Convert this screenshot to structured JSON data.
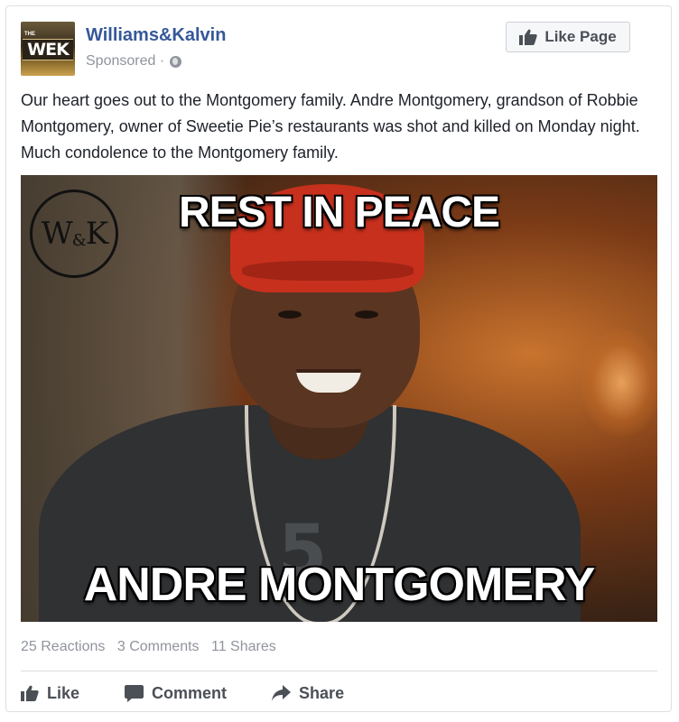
{
  "post": {
    "page_name": "Williams&Kalvin",
    "sponsored": "Sponsored ·",
    "privacy_icon": "globe-icon",
    "like_page_label": "Like Page",
    "avatar_text_small": "THE",
    "avatar_text": "WEK",
    "text": "Our heart goes out to the Montgomery family. Andre Montgomery, grandson of Robbie Montgomery, owner of Sweetie Pie’s restaurants was shot and killed on Monday night. Much condolence to the Montgomery family."
  },
  "image": {
    "top_caption": "REST IN PEACE",
    "bottom_caption": "ANDRE MONTGOMERY",
    "watermark_left": "W",
    "watermark_amp": "&",
    "watermark_right": "K",
    "shirt_number": "5"
  },
  "stats": {
    "reactions": "25 Reactions",
    "comments": "3 Comments",
    "shares": "11 Shares"
  },
  "actions": {
    "like": "Like",
    "comment": "Comment",
    "share": "Share"
  },
  "colors": {
    "link_blue": "#365899",
    "meta_gray": "#90949c",
    "action_gray": "#4b4f56"
  }
}
